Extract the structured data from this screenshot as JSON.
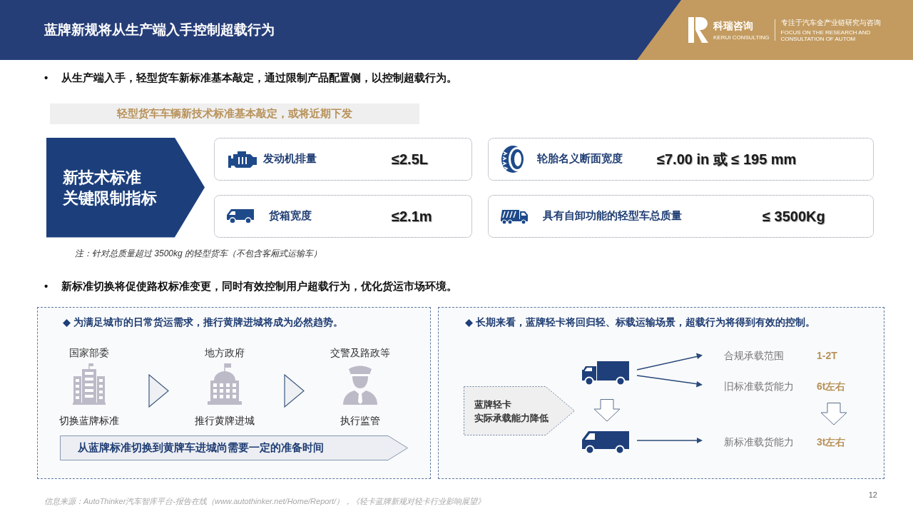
{
  "header": {
    "title": "蓝牌新规将从生产端入手控制超载行为",
    "brand": "科瑞咨询",
    "brand_en": "KERUI CONSULTING",
    "tagline": "专注于汽车全产业链研究与咨询",
    "tagline_en": [
      "FOCUS ON THE RESEARCH AND",
      "CONSULTATION OF AUTOM"
    ]
  },
  "point_1": {
    "bullet": "•",
    "text": "从生产端入手，轻型货车新标准基本敲定，通过限制产品配置侧，以控制超载行为。"
  },
  "standards": {
    "banner": "轻型货车车辆新技术标准基本敲定，或将近期下发",
    "heading": [
      "新技术标准",
      "关键限制指标"
    ],
    "items": [
      {
        "label": "发动机排量",
        "value": "≤2.5L"
      },
      {
        "label": "轮胎名义断面宽度",
        "value": "≤7.00 in 或 ≤ 195 mm"
      },
      {
        "label": "货箱宽度",
        "value": "≤2.1m"
      },
      {
        "label": "具有自卸功能的轻型车总质量",
        "value": "≤ 3500Kg"
      }
    ],
    "note": "注：针对总质量超过 3500kg 的轻型货车（不包含客厢式运输车）"
  },
  "point_2": {
    "bullet": "•",
    "text": "新标准切换将促使路权标准变更，同时有效控制用户超载行为，优化货运市场环境。"
  },
  "left_panel": {
    "heading": "为满足城市的日常货运需求，推行黄牌进城将成为必然趋势。",
    "steps": [
      {
        "actor": "国家部委",
        "action": "切换蓝牌标准"
      },
      {
        "actor": "地方政府",
        "action": "推行黄牌进城"
      },
      {
        "actor": "交警及路政等",
        "action": "执行监管"
      }
    ],
    "banner": "从蓝牌标准切换到黄牌车进城尚需要一定的准备时间"
  },
  "right_panel": {
    "heading": "长期来看，蓝牌轻卡将回归轻、标载运输场景，超载行为将得到有效的控制。",
    "callout": [
      "蓝牌轻卡",
      "实际承载能力降低"
    ],
    "outcomes": [
      {
        "label": "合规承载范围",
        "value": "1-2T"
      },
      {
        "label": "旧标准载货能力",
        "value": "6t左右"
      },
      {
        "label": "新标准载货能力",
        "value": "3t左右"
      }
    ]
  },
  "footer": {
    "source": "信息来源：AutoThinker汽车智库平台-报告在线（www.autothinker.net/Home/Report/），《轻卡蓝牌新规对轻卡行业影响展望》",
    "page": "12"
  }
}
